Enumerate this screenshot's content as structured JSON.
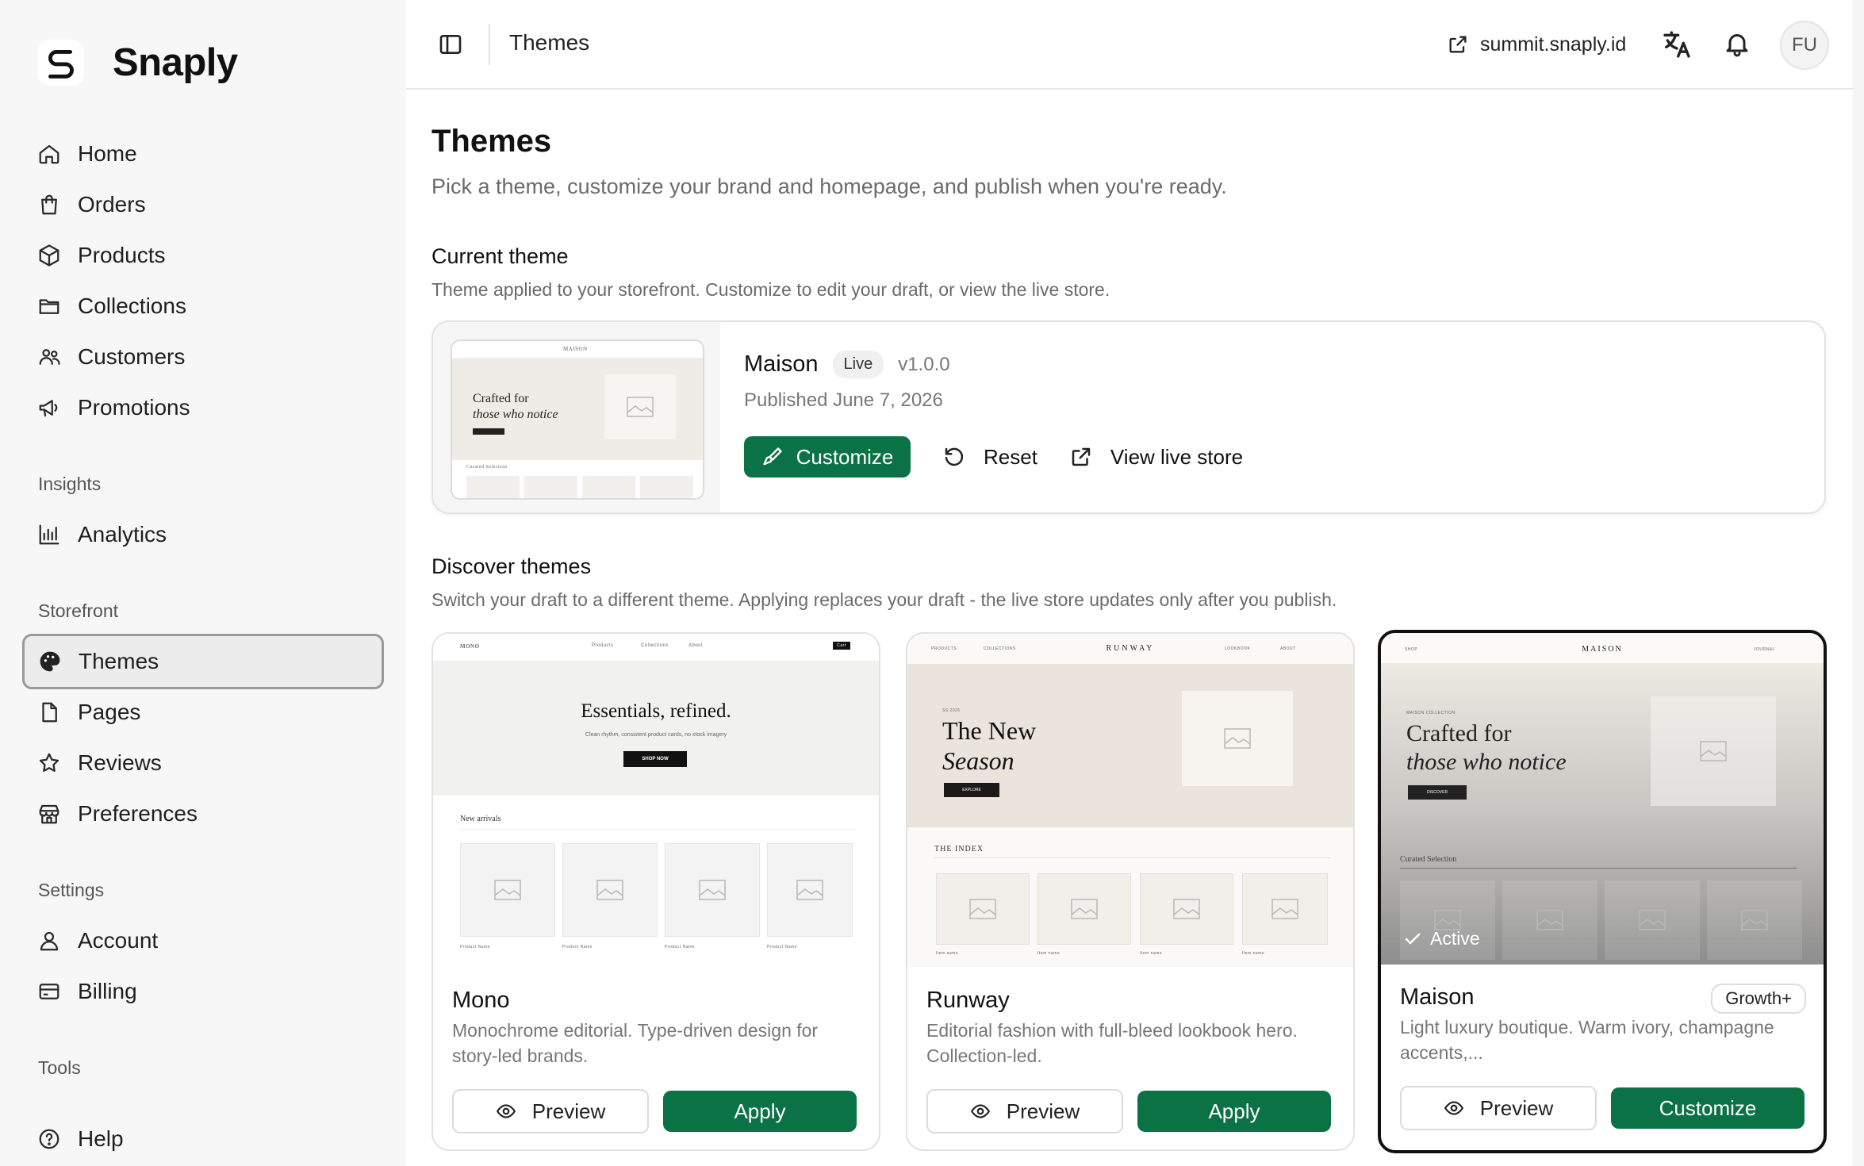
{
  "brand": {
    "name": "Snaply"
  },
  "sidebar": {
    "main_items": [
      {
        "label": "Home",
        "icon": "home-icon"
      },
      {
        "label": "Orders",
        "icon": "shopping-bag-icon"
      },
      {
        "label": "Products",
        "icon": "box-icon"
      },
      {
        "label": "Collections",
        "icon": "folder-icon"
      },
      {
        "label": "Customers",
        "icon": "users-icon"
      },
      {
        "label": "Promotions",
        "icon": "megaphone-icon"
      }
    ],
    "insights_label": "Insights",
    "insights_items": [
      {
        "label": "Analytics",
        "icon": "bar-chart-icon"
      }
    ],
    "storefront_label": "Storefront",
    "storefront_items": [
      {
        "label": "Themes",
        "icon": "palette-icon",
        "active": true
      },
      {
        "label": "Pages",
        "icon": "file-icon"
      },
      {
        "label": "Reviews",
        "icon": "star-icon"
      },
      {
        "label": "Preferences",
        "icon": "store-icon"
      }
    ],
    "settings_label": "Settings",
    "settings_items": [
      {
        "label": "Account",
        "icon": "user-icon"
      },
      {
        "label": "Billing",
        "icon": "credit-card-icon"
      }
    ],
    "tools_label": "Tools",
    "tools_items": [
      {
        "label": "Help",
        "icon": "help-circle-icon"
      }
    ]
  },
  "topbar": {
    "title": "Themes",
    "domain": "summit.snaply.id",
    "avatar_initials": "FU"
  },
  "page": {
    "title": "Themes",
    "subtitle": "Pick a theme, customize your brand and homepage, and publish when you're ready."
  },
  "current_theme": {
    "section_title": "Current theme",
    "section_subtitle": "Theme applied to your storefront. Customize to edit your draft, or view the live store.",
    "name": "Maison",
    "status": "Live",
    "version": "v1.0.0",
    "published": "Published June 7, 2026",
    "customize_label": "Customize",
    "reset_label": "Reset",
    "view_live_label": "View live store",
    "thumb": {
      "logo": "MAISON",
      "headline_1": "Crafted for",
      "headline_2": "those who notice",
      "collection": "Curated Selection"
    }
  },
  "discover": {
    "section_title": "Discover themes",
    "section_subtitle": "Switch your draft to a different theme. Applying replaces your draft - the live store updates only after you publish.",
    "preview_label": "Preview",
    "themes": [
      {
        "name": "Mono",
        "description": "Monochrome editorial. Type-driven design for story-led brands.",
        "action_label": "Apply",
        "thumb": {
          "logo": "MONO",
          "nav": [
            "Products",
            "Collections",
            "About"
          ],
          "cart": "Cart",
          "headline": "Essentials, refined.",
          "tagline": "Clean rhythm, consistent product cards, no stock imagery",
          "cta": "SHOP NOW",
          "section": "New arrivals",
          "product_label": "Product Name"
        }
      },
      {
        "name": "Runway",
        "description": "Editorial fashion with full-bleed lookbook hero. Collection-led.",
        "action_label": "Apply",
        "thumb": {
          "logo": "RUNWAY",
          "nav_left": [
            "PRODUCTS",
            "COLLECTIONS"
          ],
          "nav_right": [
            "LOOKBOOK",
            "ABOUT"
          ],
          "eyebrow": "SS 2026",
          "headline_1": "The New",
          "headline_2": "Season",
          "cta": "EXPLORE",
          "section": "THE INDEX",
          "product_label": "Item name"
        }
      },
      {
        "name": "Maison",
        "description": "Light luxury boutique. Warm ivory, champagne accents,...",
        "action_label": "Customize",
        "tier": "Growth+",
        "active_label": "Active",
        "thumb": {
          "logo": "MAISON",
          "nav_left": "SHOP",
          "nav_right": "JOURNAL",
          "eyebrow": "MAISON COLLECTION",
          "headline_1": "Crafted for",
          "headline_2": "those who notice",
          "cta": "DISCOVER",
          "section": "Curated Selection"
        }
      }
    ]
  },
  "colors": {
    "accent": "#0b7245",
    "active_border": "#111111"
  }
}
